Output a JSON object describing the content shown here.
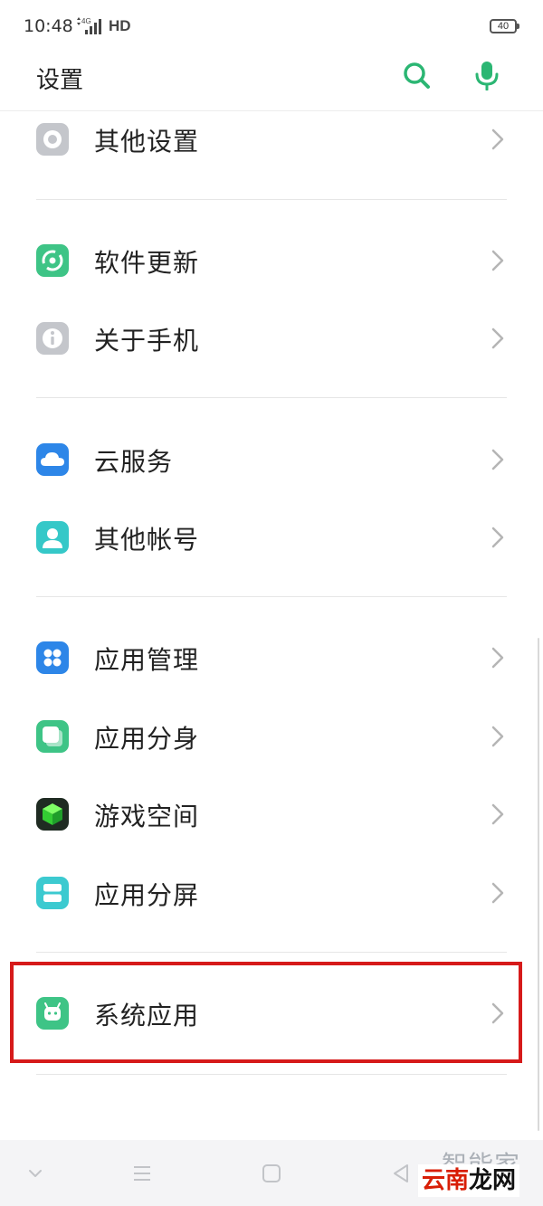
{
  "status_bar": {
    "time": "10:48",
    "network": "4G",
    "hd": "HD",
    "battery": "40"
  },
  "header": {
    "title": "设置",
    "search_icon": "search-icon",
    "mic_icon": "mic-icon",
    "accent_color": "#2bb673"
  },
  "settings": {
    "items": [
      {
        "label": "其他设置",
        "icon": "settings-icon",
        "color": "#c4c6cb"
      },
      {
        "label": "软件更新",
        "icon": "update-icon",
        "color": "#3ec486"
      },
      {
        "label": "关于手机",
        "icon": "info-icon",
        "color": "#c4c6cb"
      },
      {
        "label": "云服务",
        "icon": "cloud-icon",
        "color": "#2d86e8"
      },
      {
        "label": "其他帐号",
        "icon": "account-icon",
        "color": "#35c8c8"
      },
      {
        "label": "应用管理",
        "icon": "app-management-icon",
        "color": "#2d86e8"
      },
      {
        "label": "应用分身",
        "icon": "app-clone-icon",
        "color": "#3ec486"
      },
      {
        "label": "游戏空间",
        "icon": "game-space-icon",
        "color": "#1f2b22"
      },
      {
        "label": "应用分屏",
        "icon": "split-screen-icon",
        "color": "#3ccad0"
      },
      {
        "label": "系统应用",
        "icon": "system-apps-icon",
        "color": "#3ec486"
      }
    ],
    "highlight_color": "#d61a1a"
  },
  "nav_bar": {
    "buttons": [
      "down-arrow-icon",
      "menu-icon",
      "home-icon",
      "back-icon"
    ]
  },
  "watermark": {
    "top_text": "智能家",
    "red_text": "云南",
    "dark_text": "龙网"
  }
}
